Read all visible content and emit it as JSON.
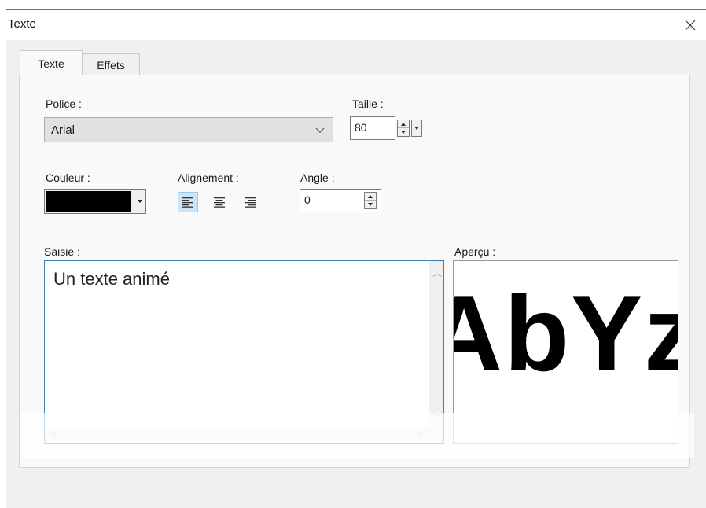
{
  "window": {
    "title": "Texte"
  },
  "tabs": [
    {
      "label": "Texte",
      "active": true
    },
    {
      "label": "Effets",
      "active": false
    }
  ],
  "police": {
    "label": "Police :",
    "value": "Arial"
  },
  "taille": {
    "label": "Taille :",
    "value": "80"
  },
  "couleur": {
    "label": "Couleur :",
    "value": "#000000"
  },
  "alignement": {
    "label": "Alignement :",
    "options": [
      "left",
      "center",
      "right"
    ],
    "selected": "left"
  },
  "angle": {
    "label": "Angle :",
    "value": "0"
  },
  "saisie": {
    "label": "Saisie :",
    "value": "Un texte animé"
  },
  "apercu": {
    "label": "Aperçu :",
    "sample": "AbYz"
  },
  "colors": {
    "accent": "#3c7fb1",
    "selection": "#cce4f7"
  }
}
